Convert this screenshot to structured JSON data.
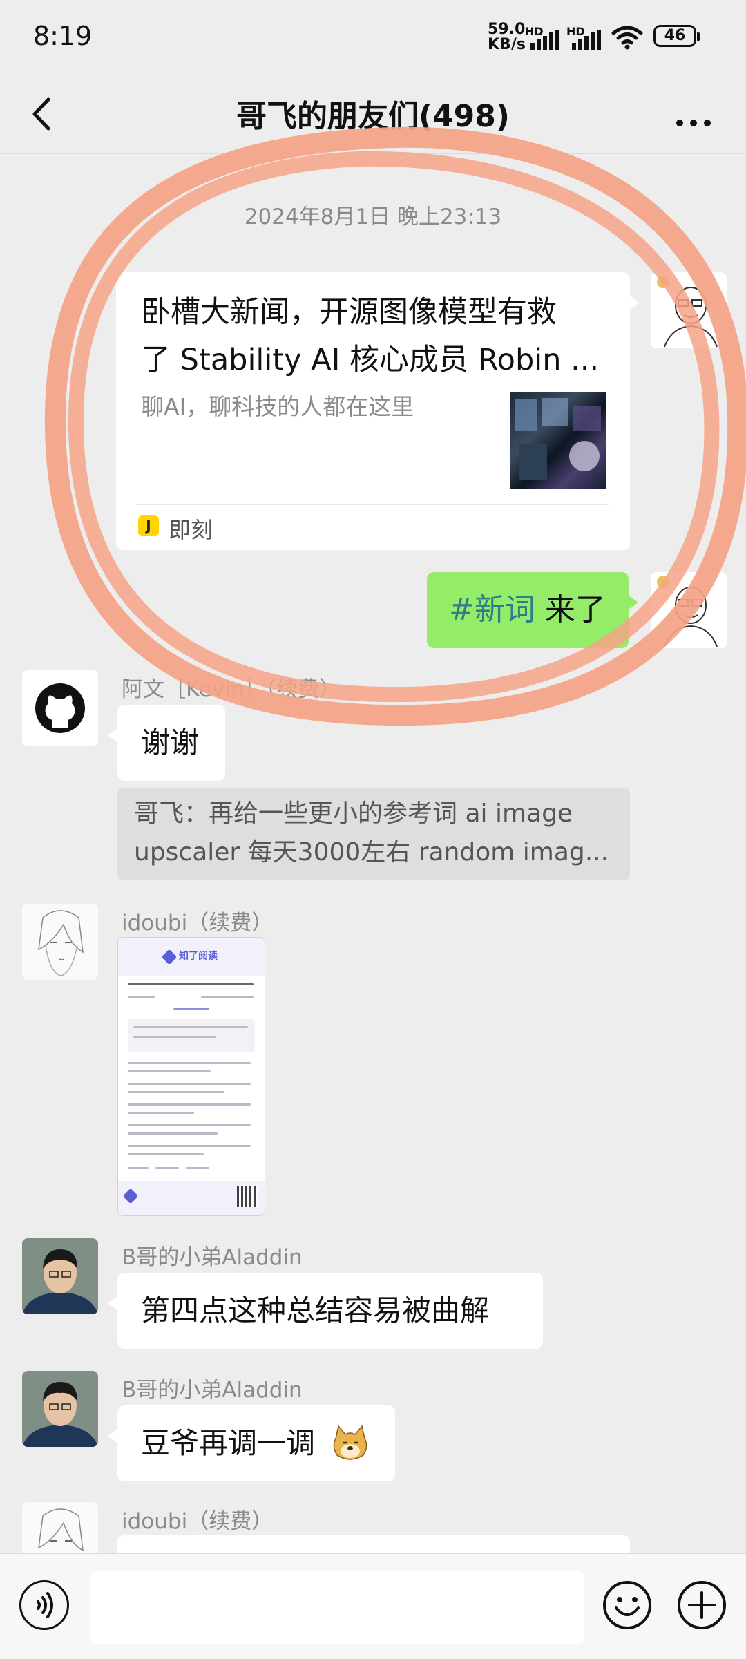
{
  "status_bar": {
    "time": "8:19",
    "net_speed_value": "59.0",
    "net_speed_unit": "KB/s",
    "signal_1_label": "HD",
    "signal_2_label": "HD",
    "battery": "46"
  },
  "header": {
    "title": "哥飞的朋友们(498)",
    "back_icon": "chevron-left-icon",
    "more_icon": "more-dots-icon"
  },
  "timestamp": "2024年8月1日 晚上23:13",
  "link_card": {
    "title_line1": "卧槽大新闻，开源图像模型有救",
    "title_line2": "了 Stability AI 核心成员 Robin ...",
    "description": "聊AI，聊科技的人都在这里",
    "source_icon_letter": "J",
    "source": "即刻"
  },
  "green_message": {
    "tag": "#新词",
    "text": " 来了"
  },
  "messages": [
    {
      "sender": "阿文［Kevin］（续费）",
      "text": "谢谢"
    },
    {
      "sender": "idoubi（续费）"
    },
    {
      "sender": "B哥的小弟Aladdin",
      "text": "第四点这种总结容易被曲解"
    },
    {
      "sender": "B哥的小弟Aladdin",
      "text": "豆爷再调一调"
    },
    {
      "sender": "idoubi（续费）"
    }
  ],
  "quote": {
    "line1": "哥飞：再给一些更小的参考词 ai image",
    "line2": "upscaler 每天3000左右 random imag..."
  },
  "doc_image": {
    "brand": "知了阅读"
  },
  "composer": {
    "voice_icon": "voice-icon",
    "emoji_icon": "emoji-icon",
    "plus_icon": "plus-icon"
  },
  "annotation_color": "#f4a386",
  "green_bubble_color": "#95ec69"
}
